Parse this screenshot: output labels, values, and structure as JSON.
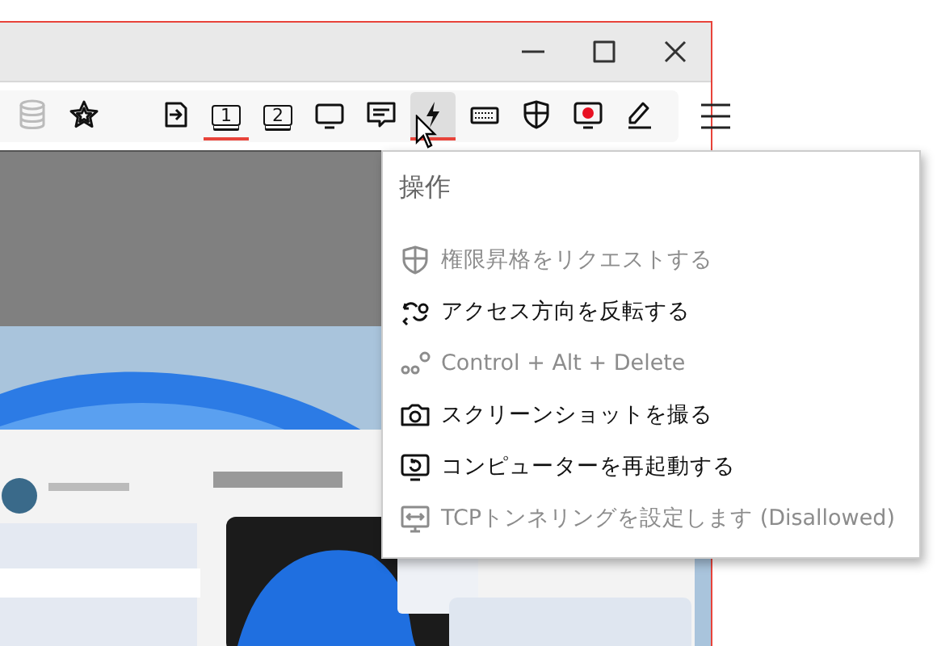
{
  "window_controls": [
    {
      "kind": "minimize"
    },
    {
      "kind": "maximize"
    },
    {
      "kind": "close"
    }
  ],
  "toolbar": [
    {
      "kind": "database",
      "disabled": true,
      "selected": false,
      "hovered": false
    },
    {
      "kind": "star",
      "disabled": false,
      "selected": false,
      "hovered": false
    },
    {
      "kind": "arrow-box",
      "disabled": false,
      "selected": false,
      "hovered": false
    },
    {
      "kind": "monitor",
      "label": "1",
      "disabled": false,
      "selected": true,
      "hovered": false
    },
    {
      "kind": "monitor",
      "label": "2",
      "disabled": false,
      "selected": false,
      "hovered": false
    },
    {
      "kind": "screen",
      "disabled": false,
      "selected": false,
      "hovered": false
    },
    {
      "kind": "chat",
      "disabled": false,
      "selected": false,
      "hovered": false
    },
    {
      "kind": "lightning",
      "disabled": false,
      "selected": true,
      "hovered": true
    },
    {
      "kind": "keyboard",
      "disabled": false,
      "selected": false,
      "hovered": false
    },
    {
      "kind": "shield",
      "disabled": false,
      "selected": false,
      "hovered": false
    },
    {
      "kind": "record",
      "disabled": false,
      "selected": false,
      "hovered": false
    },
    {
      "kind": "pen",
      "disabled": false,
      "selected": false,
      "hovered": false
    }
  ],
  "actions_menu": {
    "title": "操作",
    "items": [
      {
        "kind": "shield",
        "label": "権限昇格をリクエストする",
        "disabled": true
      },
      {
        "kind": "swap",
        "label": "アクセス方向を反転する",
        "disabled": false
      },
      {
        "kind": "keys",
        "label": "Control + Alt + Delete",
        "disabled": true
      },
      {
        "kind": "camera",
        "label": "スクリーンショットを撮る",
        "disabled": false
      },
      {
        "kind": "restart",
        "label": "コンピューターを再起動する",
        "disabled": false
      },
      {
        "kind": "tcp",
        "label": "TCPトンネリングを設定します (Disallowed)",
        "disabled": true
      }
    ]
  }
}
